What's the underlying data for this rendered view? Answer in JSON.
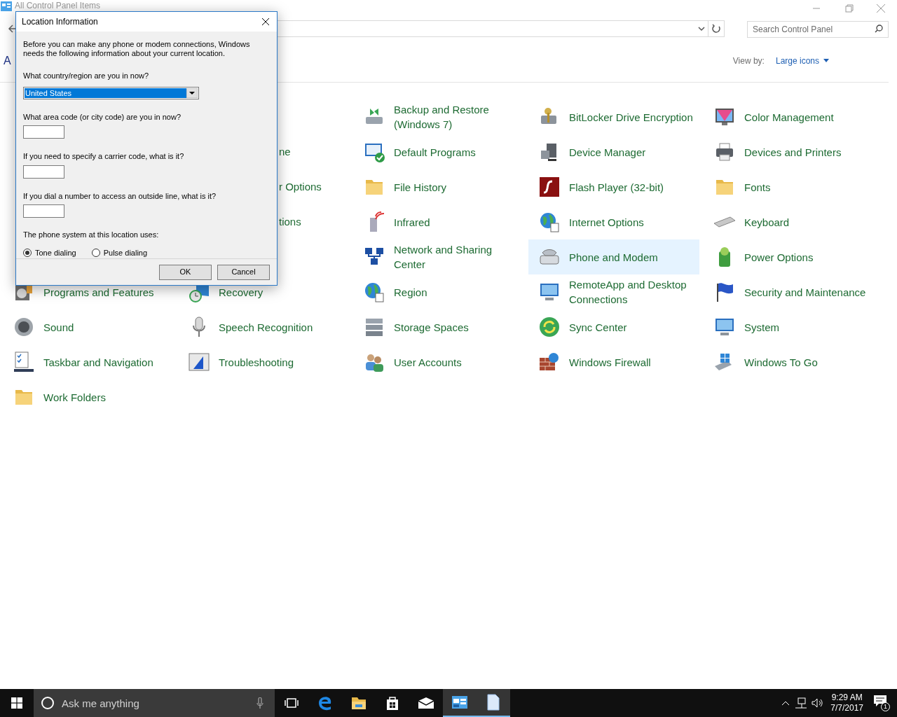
{
  "window": {
    "title": "All Control Panel Items",
    "search": {
      "placeholder": "Search Control Panel"
    },
    "heading": "A",
    "view_by": {
      "label": "View by:",
      "value": "Large icons"
    }
  },
  "rows": [
    {
      "cells": [
        {
          "kind": "covered"
        },
        {
          "kind": "covered"
        },
        {
          "kind": "item",
          "label": "Backup and Restore (Windows 7)",
          "selected": false
        },
        {
          "kind": "item",
          "label": "BitLocker Drive Encryption",
          "selected": false
        },
        {
          "kind": "item",
          "label": "Color Management",
          "selected": false
        }
      ]
    },
    {
      "cells": [
        {
          "kind": "covered"
        },
        {
          "kind": "clipped",
          "label": "ne"
        },
        {
          "kind": "item",
          "label": "Default Programs",
          "selected": false
        },
        {
          "kind": "item",
          "label": "Device Manager",
          "selected": false
        },
        {
          "kind": "item",
          "label": "Devices and Printers",
          "selected": false
        }
      ]
    },
    {
      "cells": [
        {
          "kind": "covered"
        },
        {
          "kind": "clipped",
          "label": "r Options"
        },
        {
          "kind": "item",
          "label": "File History",
          "selected": false
        },
        {
          "kind": "item",
          "label": "Flash Player (32-bit)",
          "selected": false
        },
        {
          "kind": "item",
          "label": "Fonts",
          "selected": false
        }
      ]
    },
    {
      "cells": [
        {
          "kind": "covered"
        },
        {
          "kind": "clipped",
          "label": "tions"
        },
        {
          "kind": "item",
          "label": "Infrared",
          "selected": false
        },
        {
          "kind": "item",
          "label": "Internet Options",
          "selected": false
        },
        {
          "kind": "item",
          "label": "Keyboard",
          "selected": false
        }
      ]
    },
    {
      "cells": [
        {
          "kind": "covered"
        },
        {
          "kind": "covered"
        },
        {
          "kind": "item",
          "label": "Network and Sharing Center",
          "selected": false
        },
        {
          "kind": "item",
          "label": "Phone and Modem",
          "selected": true
        },
        {
          "kind": "item",
          "label": "Power Options",
          "selected": false
        }
      ]
    },
    {
      "cells": [
        {
          "kind": "item",
          "label": "Programs and Features",
          "selected": false
        },
        {
          "kind": "item",
          "label": "Recovery",
          "selected": false
        },
        {
          "kind": "item",
          "label": "Region",
          "selected": false
        },
        {
          "kind": "item",
          "label": "RemoteApp and Desktop Connections",
          "selected": false
        },
        {
          "kind": "item",
          "label": "Security and Maintenance",
          "selected": false
        }
      ]
    },
    {
      "cells": [
        {
          "kind": "item",
          "label": "Sound",
          "selected": false
        },
        {
          "kind": "item",
          "label": "Speech Recognition",
          "selected": false
        },
        {
          "kind": "item",
          "label": "Storage Spaces",
          "selected": false
        },
        {
          "kind": "item",
          "label": "Sync Center",
          "selected": false
        },
        {
          "kind": "item",
          "label": "System",
          "selected": false
        }
      ]
    },
    {
      "cells": [
        {
          "kind": "item",
          "label": "Taskbar and Navigation",
          "selected": false
        },
        {
          "kind": "item",
          "label": "Troubleshooting",
          "selected": false
        },
        {
          "kind": "item",
          "label": "User Accounts",
          "selected": false
        },
        {
          "kind": "item",
          "label": "Windows Firewall",
          "selected": false
        },
        {
          "kind": "item",
          "label": "Windows To Go",
          "selected": false
        }
      ]
    },
    {
      "cells": [
        {
          "kind": "item",
          "label": "Work Folders",
          "selected": false
        }
      ]
    }
  ],
  "dialog": {
    "title": "Location Information",
    "intro": "Before you can make any phone or modem connections, Windows needs the following information about your current location.",
    "country": {
      "label": "What country/region are you in now?",
      "value": "United States"
    },
    "fields": [
      {
        "label": "What area code (or city code) are you in now?"
      },
      {
        "label": "If you need to specify a carrier code, what is it?"
      },
      {
        "label": "If you dial a number to access an outside line, what is it?"
      }
    ],
    "dialing_label": "The phone system at this location uses:",
    "dialing": [
      {
        "label": "Tone dialing",
        "selected": true
      },
      {
        "label": "Pulse dialing",
        "selected": false
      }
    ],
    "buttons": [
      "OK",
      "Cancel"
    ]
  },
  "taskbar": {
    "search": {
      "placeholder": "Ask me anything"
    },
    "apps": [
      {
        "kind": "task-view",
        "selected": false
      },
      {
        "kind": "browser",
        "selected": false
      },
      {
        "kind": "explorer",
        "selected": false
      },
      {
        "kind": "store",
        "selected": false
      },
      {
        "kind": "mail",
        "selected": false
      },
      {
        "kind": "control-panel",
        "selected": true
      },
      {
        "kind": "document",
        "selected": true
      }
    ],
    "time": "9:29 AM",
    "date": "7/7/2017",
    "notifications": "1"
  }
}
